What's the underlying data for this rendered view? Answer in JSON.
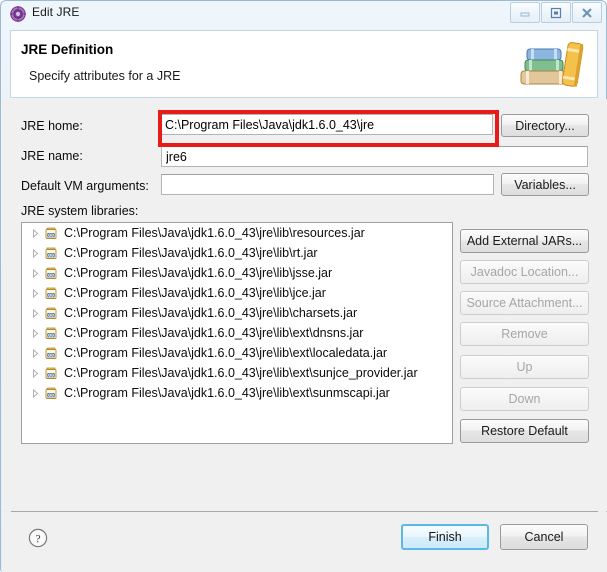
{
  "window": {
    "title": "Edit JRE",
    "icon": "jre-gear-icon",
    "controls": {
      "minimize": "minimize-icon",
      "maximize": "maximize-icon",
      "close": "close-icon"
    }
  },
  "header": {
    "title": "JRE Definition",
    "subtitle": "Specify attributes for a JRE",
    "image": "books-stack-icon"
  },
  "form": {
    "jre_home": {
      "label": "JRE home:",
      "value": "C:\\Program Files\\Java\\jdk1.6.0_43\\jre",
      "placeholder": "",
      "button": "Directory...",
      "highlight_color": "#e81b1b"
    },
    "jre_name": {
      "label": "JRE name:",
      "value": "jre6",
      "placeholder": ""
    },
    "vm_args": {
      "label": "Default VM arguments:",
      "value": "",
      "placeholder": "",
      "button": "Variables..."
    },
    "system_libraries": {
      "label": "JRE system libraries:",
      "items": [
        {
          "path": "C:\\Program Files\\Java\\jdk1.6.0_43\\jre\\lib\\resources.jar",
          "icon": "jar-icon",
          "expandable": true
        },
        {
          "path": "C:\\Program Files\\Java\\jdk1.6.0_43\\jre\\lib\\rt.jar",
          "icon": "jar-icon",
          "expandable": true
        },
        {
          "path": "C:\\Program Files\\Java\\jdk1.6.0_43\\jre\\lib\\jsse.jar",
          "icon": "jar-icon",
          "expandable": true
        },
        {
          "path": "C:\\Program Files\\Java\\jdk1.6.0_43\\jre\\lib\\jce.jar",
          "icon": "jar-icon",
          "expandable": true
        },
        {
          "path": "C:\\Program Files\\Java\\jdk1.6.0_43\\jre\\lib\\charsets.jar",
          "icon": "jar-icon",
          "expandable": true
        },
        {
          "path": "C:\\Program Files\\Java\\jdk1.6.0_43\\jre\\lib\\ext\\dnsns.jar",
          "icon": "jar-icon",
          "expandable": true
        },
        {
          "path": "C:\\Program Files\\Java\\jdk1.6.0_43\\jre\\lib\\ext\\localedata.jar",
          "icon": "jar-icon",
          "expandable": true
        },
        {
          "path": "C:\\Program Files\\Java\\jdk1.6.0_43\\jre\\lib\\ext\\sunjce_provider.jar",
          "icon": "jar-icon",
          "expandable": true
        },
        {
          "path": "C:\\Program Files\\Java\\jdk1.6.0_43\\jre\\lib\\ext\\sunmscapi.jar",
          "icon": "jar-icon",
          "expandable": true
        }
      ]
    }
  },
  "side_buttons": [
    {
      "label": "Add External JARs...",
      "enabled": true
    },
    {
      "label": "Javadoc Location...",
      "enabled": false
    },
    {
      "label": "Source Attachment...",
      "enabled": false
    },
    {
      "label": "Remove",
      "enabled": false
    },
    {
      "label": "Up",
      "enabled": false
    },
    {
      "label": "Down",
      "enabled": false
    },
    {
      "label": "Restore Default",
      "enabled": true
    }
  ],
  "footer": {
    "help": "help-icon",
    "finish": "Finish",
    "cancel": "Cancel",
    "default_button_accent": "#5bb9e3"
  }
}
